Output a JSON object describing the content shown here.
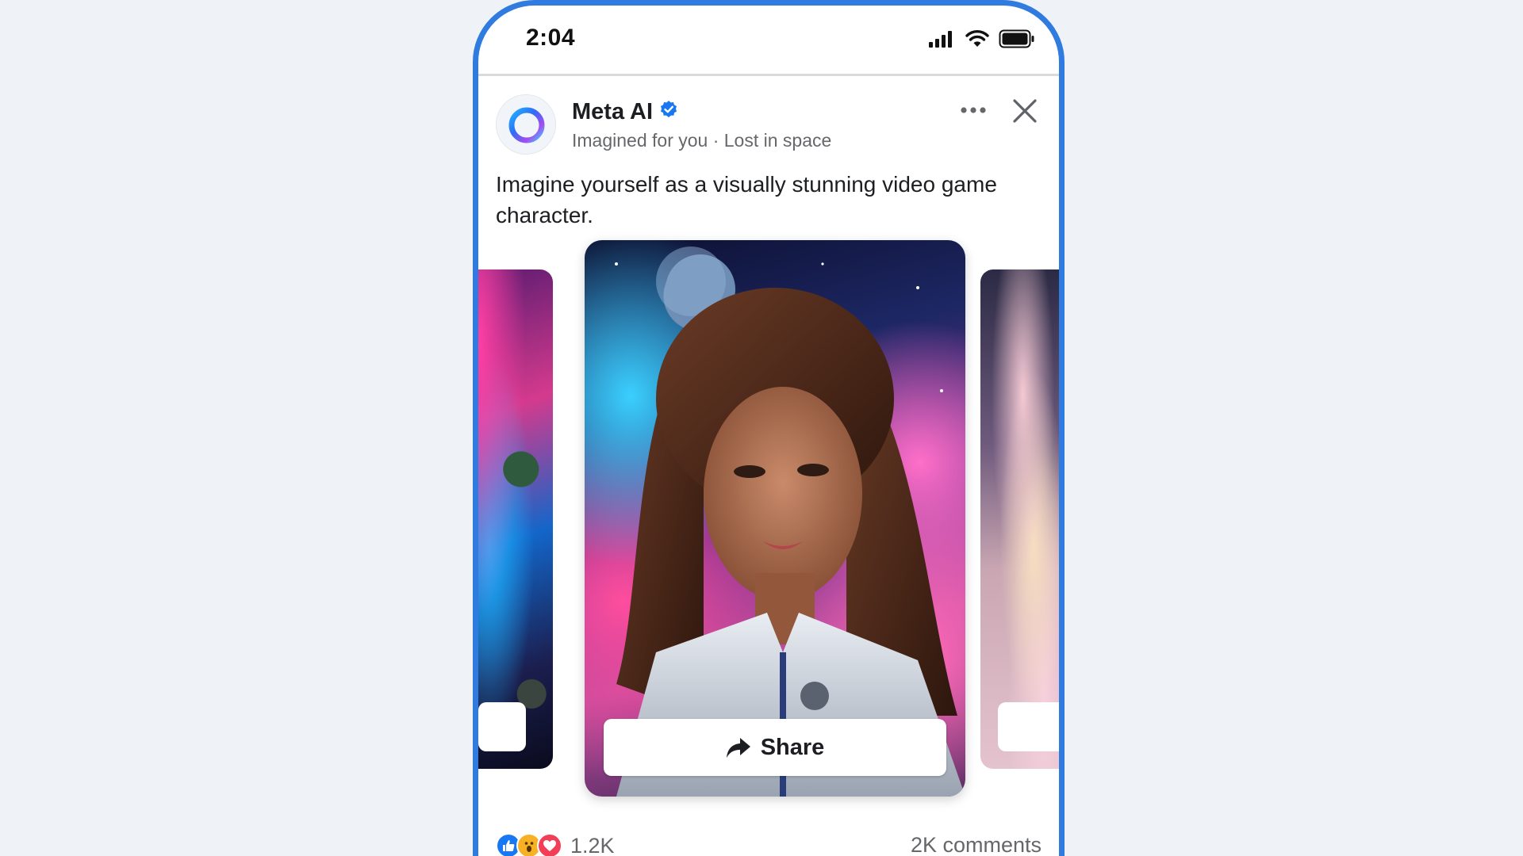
{
  "status_bar": {
    "time": "2:04",
    "icons": [
      "cellular-signal-icon",
      "wifi-icon",
      "battery-icon"
    ]
  },
  "post": {
    "author": "Meta AI",
    "verified": true,
    "subtitle": "Imagined for you · Lost in space",
    "text": "Imagine yourself as a visually stunning video game character.",
    "actions": [
      "more-options-icon",
      "close-icon"
    ]
  },
  "carousel": {
    "cards": [
      {
        "position": "previous",
        "description": "astronaut in colorful space scene"
      },
      {
        "position": "current",
        "description": "young woman in space suit with planets and nebula behind her"
      },
      {
        "position": "next",
        "description": "astronaut among pink clouds"
      }
    ],
    "share_label": "Share"
  },
  "footer": {
    "reactions": [
      "like",
      "wow",
      "love"
    ],
    "reaction_count": "1.2K",
    "comments": "2K comments"
  },
  "colors": {
    "frame": "#2f7bdf",
    "verified": "#1877f2",
    "like": "#1877f2",
    "love": "#f33e58",
    "wow": "#f7b125",
    "secondary_text": "#65676b"
  }
}
